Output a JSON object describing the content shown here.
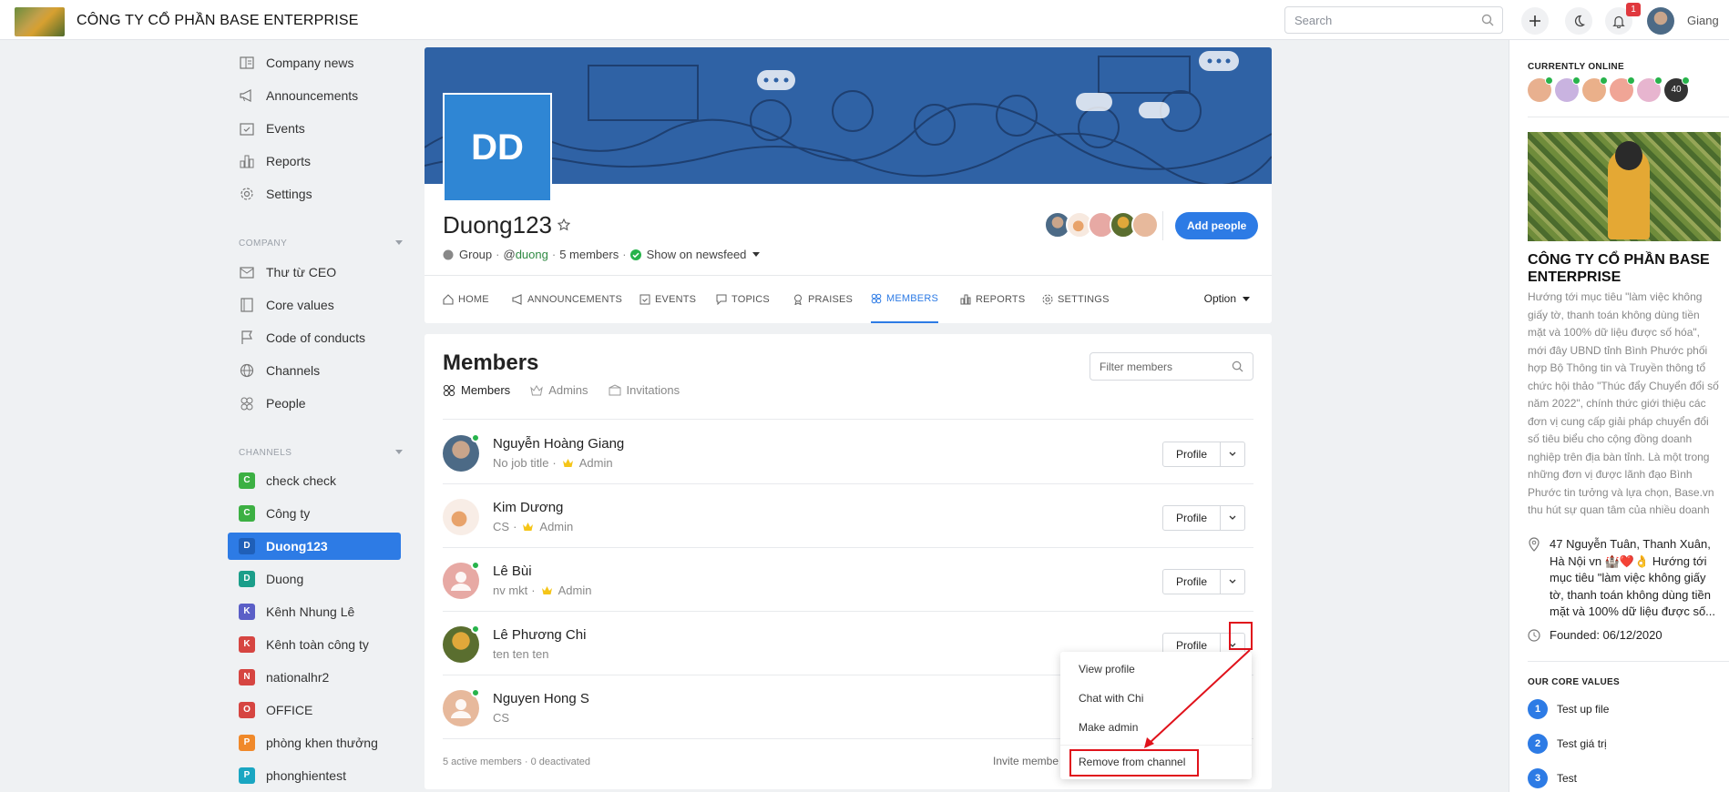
{
  "header": {
    "company_name": "CÔNG TY CỔ PHẦN BASE ENTERPRISE",
    "search_placeholder": "Search",
    "notification_count": "1",
    "user_name": "Giang"
  },
  "sidebar": {
    "main_items": [
      {
        "label": "Company news",
        "icon": "newspaper-icon"
      },
      {
        "label": "Announcements",
        "icon": "megaphone-icon"
      },
      {
        "label": "Events",
        "icon": "calendar-check-icon"
      },
      {
        "label": "Reports",
        "icon": "bar-chart-icon"
      },
      {
        "label": "Settings",
        "icon": "gear-icon"
      }
    ],
    "company_heading": "COMPANY",
    "company_items": [
      {
        "label": "Thư từ CEO",
        "icon": "mail-icon"
      },
      {
        "label": "Core values",
        "icon": "book-icon"
      },
      {
        "label": "Code of conducts",
        "icon": "flag-icon"
      },
      {
        "label": "Channels",
        "icon": "globe-icon"
      },
      {
        "label": "People",
        "icon": "people-icon"
      }
    ],
    "channels_heading": "CHANNELS",
    "channels": [
      {
        "letter": "C",
        "label": "check check",
        "color": "#3cb043"
      },
      {
        "letter": "C",
        "label": "Công ty",
        "color": "#3cb043"
      },
      {
        "letter": "D",
        "label": "Duong123",
        "color": "#2d7be5",
        "active": true
      },
      {
        "letter": "D",
        "label": "Duong",
        "color": "#1b9e8a"
      },
      {
        "letter": "K",
        "label": "Kênh Nhung Lê",
        "color": "#5b5fc7"
      },
      {
        "letter": "K",
        "label": "Kênh toàn công ty",
        "color": "#d64541"
      },
      {
        "letter": "N",
        "label": "nationalhr2",
        "color": "#d64541"
      },
      {
        "letter": "O",
        "label": "OFFICE",
        "color": "#d64541"
      },
      {
        "letter": "P",
        "label": "phòng khen thưởng",
        "color": "#f0892a"
      },
      {
        "letter": "P",
        "label": "phonghientest",
        "color": "#1aa6c2"
      }
    ]
  },
  "group": {
    "initials": "DD",
    "name": "Duong123",
    "type": "Group",
    "handle_prefix": "@",
    "handle": "duong",
    "members_count": "5 members",
    "newsfeed": "Show on newsfeed",
    "add_people": "Add people",
    "tabs": [
      "HOME",
      "ANNOUNCEMENTS",
      "EVENTS",
      "TOPICS",
      "PRAISES",
      "MEMBERS",
      "REPORTS",
      "SETTINGS"
    ],
    "active_tab": "MEMBERS",
    "option": "Option"
  },
  "members_panel": {
    "title": "Members",
    "filter_placeholder": "Filter members",
    "subtabs": [
      "Members",
      "Admins",
      "Invitations"
    ],
    "profile_label": "Profile",
    "list": [
      {
        "name": "Nguyễn Hoàng Giang",
        "sub": "No job title",
        "role": "Admin"
      },
      {
        "name": "Kim Dương",
        "sub": "CS",
        "role": "Admin"
      },
      {
        "name": "Lê Bùi",
        "sub": "nv mkt",
        "role": "Admin"
      },
      {
        "name": "Lê Phương Chi",
        "sub": "ten ten ten",
        "role": ""
      },
      {
        "name": "Nguyen Hong S",
        "sub": "CS",
        "role": ""
      }
    ],
    "footer": "5 active members · 0 deactivated",
    "invite": "Invite membe"
  },
  "dropdown_menu": {
    "items": [
      "View profile",
      "Chat with Chi",
      "Make admin",
      "Remove from channel"
    ]
  },
  "rightbar": {
    "online_heading": "CURRENTLY ONLINE",
    "online_more": "40",
    "company_name": "CÔNG TY CỔ PHẦN BASE ENTERPRISE",
    "description": "Hướng tới mục tiêu \"làm việc không giấy tờ, thanh toán không dùng tiền mặt và 100% dữ liệu được số hóa\", mới đây UBND tỉnh Bình Phước phối hợp Bộ Thông tin và Truyền thông tổ chức hội thảo \"Thúc đẩy Chuyển đổi số năm 2022\", chính thức giới thiệu các đơn vị cung cấp giải pháp chuyển đổi số tiêu biểu cho cộng đồng doanh nghiệp trên địa bàn tỉnh. Là một trong những đơn vị được lãnh đạo Bình Phước tin tưởng và lựa chọn, Base.vn thu hút sự quan tâm của nhiều doanh nghiệp SMEs. Theo...",
    "address": "47 Nguyễn Tuân, Thanh Xuân, Hà Nội vn 🏰❤️👌 Hướng tới mục tiêu \"làm việc không giấy tờ, thanh toán không dùng tiền mặt và 100% dữ liệu được số...",
    "founded": "Founded: 06/12/2020",
    "core_heading": "OUR CORE VALUES",
    "core_values": [
      {
        "num": "1",
        "label": "Test up file"
      },
      {
        "num": "2",
        "label": "Test giá trị"
      },
      {
        "num": "3",
        "label": "Test"
      }
    ]
  }
}
